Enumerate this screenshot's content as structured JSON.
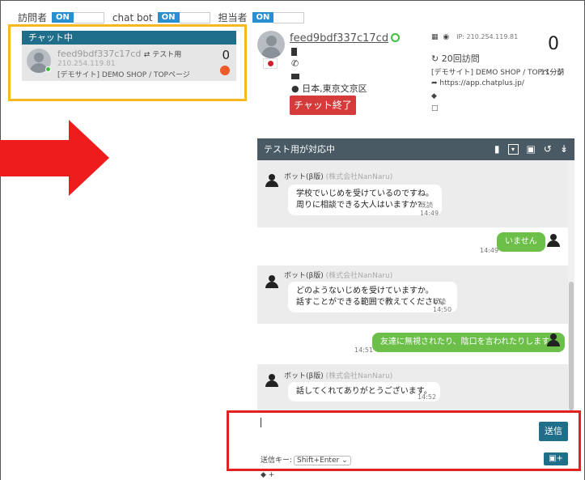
{
  "toggles": [
    {
      "label": "訪問者",
      "state": "ON"
    },
    {
      "label": "chat bot",
      "state": "ON"
    },
    {
      "label": "担当者",
      "state": "ON"
    }
  ],
  "chat_list": {
    "header": "チャット中",
    "item": {
      "name": "feed9bdf337c17cd",
      "tag": "⇄ テスト用",
      "ip": "210.254.119.81",
      "page": "[デモサイト] DEMO SHOP / TOPページ",
      "count": "0"
    }
  },
  "visitor": {
    "name": "feed9bdf337c17cd",
    "location": "日本,東京文京区",
    "end_chat_label": "チャット終了",
    "ip": "IP: 210.254.119.81",
    "visits": "20回訪問",
    "page": "[デモサイト] DEMO SHOP / TOPページ",
    "page_time": "11分前",
    "referrer": "https://app.chatplus.jp/",
    "unread": "0"
  },
  "chat": {
    "title": "テスト用が対応中",
    "messages": [
      {
        "type": "bot",
        "sender": "ボット(β版)",
        "company": "(株式会社NanNaru)",
        "lines": [
          "学校でいじめを受けているのですね。",
          "周りに相談できる大人はいますか?"
        ],
        "read": "既読",
        "time": "14:49"
      },
      {
        "type": "user",
        "text": "いません",
        "time": "14:49"
      },
      {
        "type": "bot",
        "sender": "ボット(β版)",
        "company": "(株式会社NanNaru)",
        "lines": [
          "どのようないじめを受けていますか。",
          "話すことができる範囲で教えてください。"
        ],
        "read": "既読",
        "time": "14:50"
      },
      {
        "type": "user",
        "text": "友達に無視されたり、陰口を言われたりします。",
        "time": "14:51"
      },
      {
        "type": "bot",
        "sender": "ボット(β版)",
        "company": "(株式会社NanNaru)",
        "lines": [
          "話してくれてありがとうございます。"
        ],
        "read": "",
        "time": "14:52"
      }
    ]
  },
  "composer": {
    "send_label": "送信",
    "send_key_label": "送信キー:",
    "send_key_value": "Shift+Enter",
    "tag_label": "+"
  },
  "colors": {
    "accent": "#1f6f8b",
    "end_button": "#d63b3b",
    "user_bubble": "#6cc04a",
    "highlight_yellow": "#f5b820",
    "highlight_red": "#e42020",
    "arrow_red": "#ee1c1c"
  }
}
